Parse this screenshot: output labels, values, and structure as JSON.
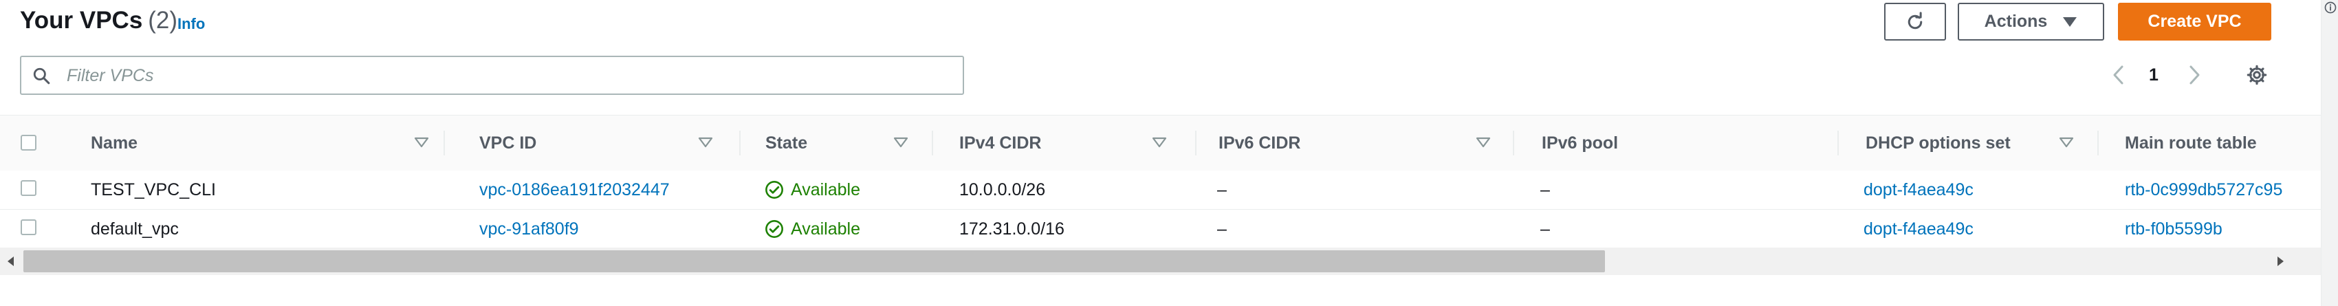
{
  "header": {
    "title": "Your VPCs",
    "count": "(2)",
    "info_link": "Info"
  },
  "toolbar": {
    "refresh_icon": "refresh-icon",
    "actions_label": "Actions",
    "create_label": "Create VPC"
  },
  "search": {
    "placeholder": "Filter VPCs",
    "value": ""
  },
  "pagination": {
    "current_page": "1"
  },
  "table": {
    "columns": [
      "Name",
      "VPC ID",
      "State",
      "IPv4 CIDR",
      "IPv6 CIDR",
      "IPv6 pool",
      "DHCP options set",
      "Main route table"
    ],
    "rows": [
      {
        "name": "TEST_VPC_CLI",
        "vpc_id": "vpc-0186ea191f2032447",
        "state": "Available",
        "ipv4_cidr": "10.0.0.0/26",
        "ipv6_cidr": "–",
        "ipv6_pool": "–",
        "dhcp_options_set": "dopt-f4aea49c",
        "main_route_table": "rtb-0c999db5727c95"
      },
      {
        "name": "default_vpc",
        "vpc_id": "vpc-91af80f9",
        "state": "Available",
        "ipv4_cidr": "172.31.0.0/16",
        "ipv6_cidr": "–",
        "ipv6_pool": "–",
        "dhcp_options_set": "dopt-f4aea49c",
        "main_route_table": "rtb-f0b5599b"
      }
    ]
  },
  "colors": {
    "primary_button": "#ec7211",
    "link": "#0073bb",
    "status_available": "#1d8102"
  }
}
